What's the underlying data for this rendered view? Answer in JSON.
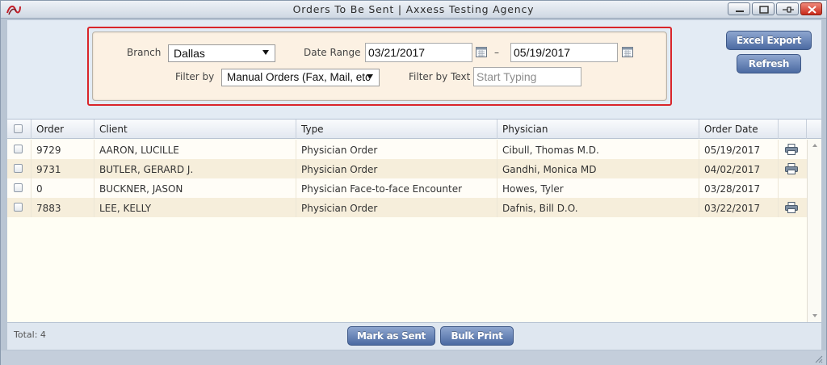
{
  "window": {
    "title": "Orders To Be Sent | Axxess Testing Agency"
  },
  "filters": {
    "branch_label": "Branch",
    "branch_value": "Dallas",
    "date_range_label": "Date Range",
    "date_from": "03/21/2017",
    "date_separator": "–",
    "date_to": "05/19/2017",
    "filter_by_label": "Filter by",
    "filter_by_value": "Manual Orders (Fax, Mail, etc",
    "filter_text_label": "Filter by Text",
    "filter_text_placeholder": "Start Typing"
  },
  "actions": {
    "excel_export": "Excel Export",
    "refresh": "Refresh"
  },
  "table": {
    "columns": [
      "Order",
      "Client",
      "Type",
      "Physician",
      "Order Date"
    ],
    "rows": [
      {
        "order": "9729",
        "client": "AARON, LUCILLE",
        "type": "Physician Order",
        "physician": "Cibull, Thomas M.D.",
        "date": "05/19/2017",
        "printable": true
      },
      {
        "order": "9731",
        "client": "BUTLER, GERARD J.",
        "type": "Physician Order",
        "physician": "Gandhi, Monica MD",
        "date": "04/02/2017",
        "printable": true
      },
      {
        "order": "0",
        "client": "BUCKNER, JASON",
        "type": "Physician Face-to-face Encounter",
        "physician": "Howes, Tyler",
        "date": "03/28/2017",
        "printable": false
      },
      {
        "order": "7883",
        "client": "LEE, KELLY",
        "type": "Physician Order",
        "physician": "Dafnis, Bill D.O.",
        "date": "03/22/2017",
        "printable": true
      }
    ]
  },
  "footer": {
    "total": "Total: 4",
    "mark_as_sent": "Mark as Sent",
    "bulk_print": "Bulk Print"
  },
  "colors": {
    "highlight_border": "#d9252a",
    "button": "#4b6aa2",
    "row_alt": "#f6eedb",
    "filter_bg": "#fcf1e3"
  },
  "icons": {
    "app": "app-logo-icon",
    "calendar": "calendar-icon",
    "print": "printer-icon"
  }
}
